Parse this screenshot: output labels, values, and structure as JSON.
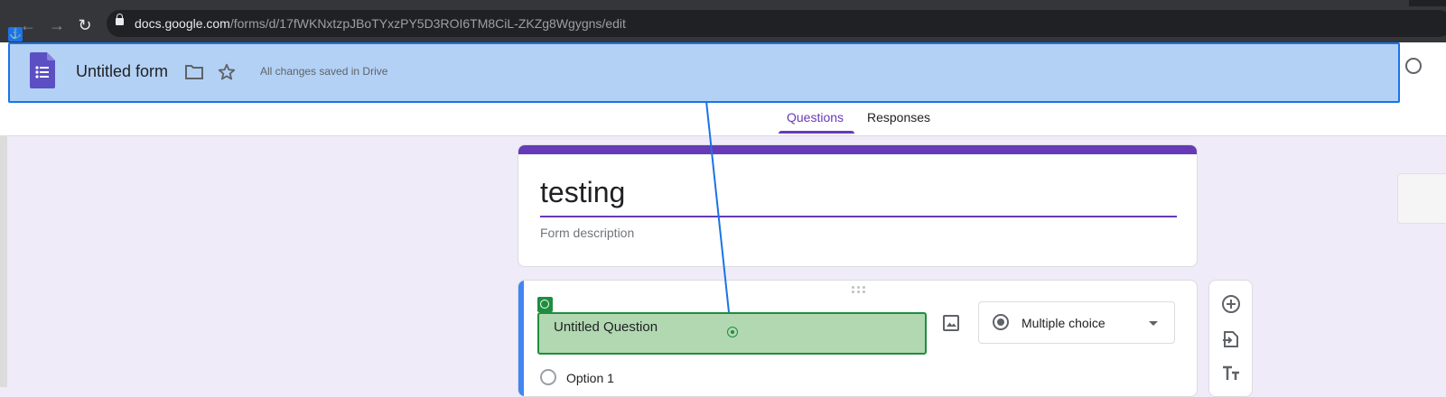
{
  "browser": {
    "url_host": "docs.google.com",
    "url_path": "/forms/d/17fWKNxtzpJBoTYxzPY5D3ROI6TM8CiL-ZKZg8Wgygns/edit",
    "back_icon": "arrow-left-icon",
    "forward_icon": "arrow-right-icon",
    "reload_icon": "reload-icon",
    "lock_icon": "lock-icon"
  },
  "header": {
    "title": "Untitled form",
    "saved_status": "All changes saved in Drive",
    "icons": [
      "google-forms-icon",
      "folder-icon",
      "star-icon",
      "palette-icon"
    ]
  },
  "tabs": [
    {
      "label": "Questions",
      "active": true
    },
    {
      "label": "Responses",
      "active": false
    }
  ],
  "form": {
    "title": "testing",
    "description_placeholder": "Form description"
  },
  "question": {
    "title": "Untitled Question",
    "type": "Multiple choice",
    "options": [
      "Option 1"
    ]
  },
  "colors": {
    "accent": "#673ab7",
    "highlight_blue": "#b3d1f5",
    "highlight_green": "#b2d8b1",
    "question_border": "#4285f4"
  }
}
